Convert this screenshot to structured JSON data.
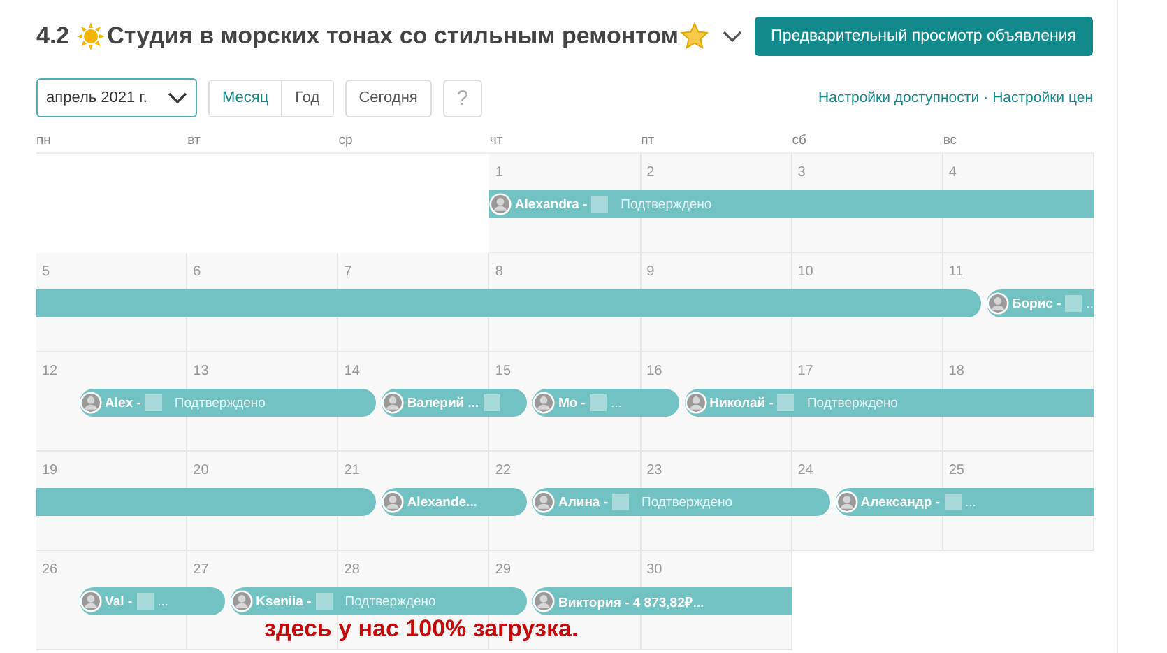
{
  "header": {
    "rating": "4.2",
    "title": "Студия в морских тонах со стильным ремонтом",
    "preview_button": "Предварительный просмотр объявления"
  },
  "toolbar": {
    "month_select": "апрель 2021 г.",
    "view_tabs": [
      {
        "label": "Месяц",
        "selected": true
      },
      {
        "label": "Год",
        "selected": false
      }
    ],
    "today_button": "Сегодня",
    "help_button": "?",
    "links": [
      "Настройки доступности",
      "Настройки цен"
    ],
    "link_separator": "·"
  },
  "weekdays": [
    "пн",
    "вт",
    "ср",
    "чт",
    "пт",
    "сб",
    "вс"
  ],
  "weeks": [
    {
      "days": [
        {
          "kind": "empty"
        },
        {
          "kind": "empty"
        },
        {
          "kind": "empty"
        },
        {
          "kind": "through",
          "number": "1",
          "guest": {
            "name": "Alexandra -",
            "redacted": true,
            "status": "Подтверждено"
          }
        },
        {
          "kind": "through",
          "number": "2"
        },
        {
          "kind": "through",
          "number": "3"
        },
        {
          "kind": "through",
          "number": "4"
        }
      ]
    },
    {
      "days": [
        {
          "kind": "through",
          "number": "5"
        },
        {
          "kind": "through",
          "number": "6"
        },
        {
          "kind": "through",
          "number": "7"
        },
        {
          "kind": "through",
          "number": "8"
        },
        {
          "kind": "through",
          "number": "9"
        },
        {
          "kind": "through",
          "number": "10"
        },
        {
          "kind": "turnover",
          "number": "11",
          "guest": {
            "name": "Борис -",
            "redacted": true,
            "tail": "..."
          }
        }
      ]
    },
    {
      "days": [
        {
          "kind": "turnover",
          "number": "12",
          "guest": {
            "name": "Alex -",
            "redacted": true,
            "status": "Подтверждено"
          }
        },
        {
          "kind": "through",
          "number": "13"
        },
        {
          "kind": "turnover",
          "number": "14",
          "guest": {
            "name": "Валерий ...",
            "redacted": true
          }
        },
        {
          "kind": "turnover",
          "number": "15",
          "guest": {
            "name": "Мо -",
            "redacted": true,
            "tail": "..."
          }
        },
        {
          "kind": "turnover",
          "number": "16",
          "guest": {
            "name": "Николай -",
            "redacted": true,
            "status": "Подтверждено"
          }
        },
        {
          "kind": "through",
          "number": "17"
        },
        {
          "kind": "through",
          "number": "18"
        }
      ]
    },
    {
      "days": [
        {
          "kind": "through",
          "number": "19"
        },
        {
          "kind": "through",
          "number": "20"
        },
        {
          "kind": "turnover",
          "number": "21",
          "guest": {
            "name": "Alexande...",
            "redacted": false
          }
        },
        {
          "kind": "turnover",
          "number": "22",
          "guest": {
            "name": "Алина -",
            "redacted": true,
            "status": "Подтверждено"
          }
        },
        {
          "kind": "through",
          "number": "23"
        },
        {
          "kind": "turnover",
          "number": "24",
          "guest": {
            "name": "Александр -",
            "redacted": true,
            "tail": "..."
          }
        },
        {
          "kind": "through",
          "number": "25"
        }
      ]
    },
    {
      "days": [
        {
          "kind": "turnover",
          "number": "26",
          "guest": {
            "name": "Val -",
            "redacted": true,
            "tail": "..."
          }
        },
        {
          "kind": "turnover",
          "number": "27",
          "guest": {
            "name": "Kseniia -",
            "redacted": true,
            "status": "Подтверждено"
          }
        },
        {
          "kind": "through",
          "number": "28"
        },
        {
          "kind": "turnover",
          "number": "29",
          "guest": {
            "name": "Виктория - 4 873,82₽...",
            "redacted": false
          }
        },
        {
          "kind": "last",
          "number": "30"
        },
        {
          "kind": "empty"
        },
        {
          "kind": "empty"
        }
      ]
    }
  ],
  "annotation": "здесь у нас 100% загрузка."
}
